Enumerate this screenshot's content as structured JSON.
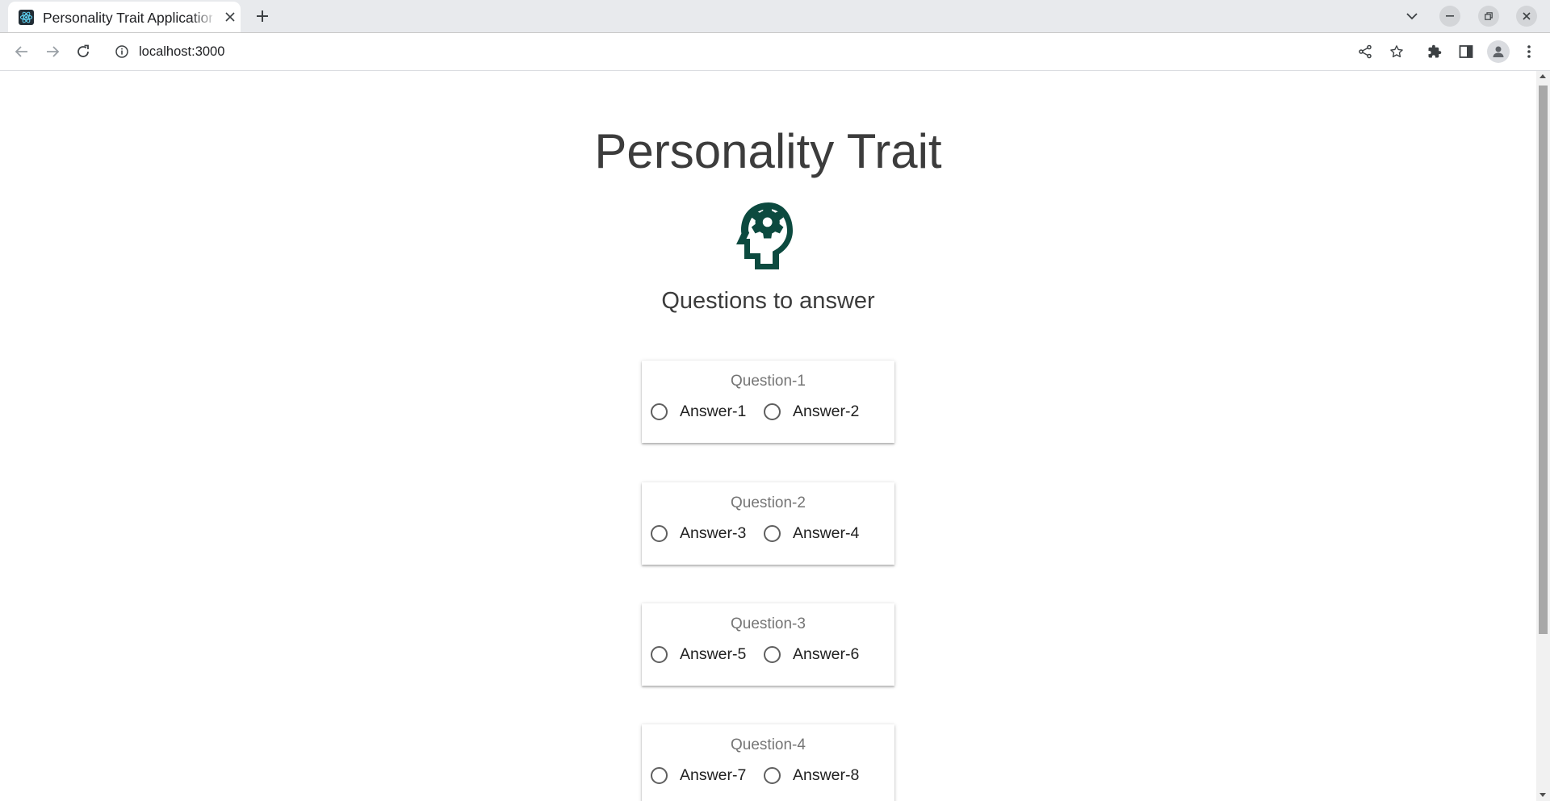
{
  "browser": {
    "tab_title": "Personality Trait Application",
    "url": "localhost:3000"
  },
  "page": {
    "title": "Personality Trait",
    "subtitle": "Questions to answer",
    "icon": "psychology-head-gear-icon",
    "icon_color": "#0c4a3f"
  },
  "questions": [
    {
      "label": "Question-1",
      "answers": [
        "Answer-1",
        "Answer-2"
      ]
    },
    {
      "label": "Question-2",
      "answers": [
        "Answer-3",
        "Answer-4"
      ]
    },
    {
      "label": "Question-3",
      "answers": [
        "Answer-5",
        "Answer-6"
      ]
    },
    {
      "label": "Question-4",
      "answers": [
        "Answer-7",
        "Answer-8"
      ]
    }
  ]
}
